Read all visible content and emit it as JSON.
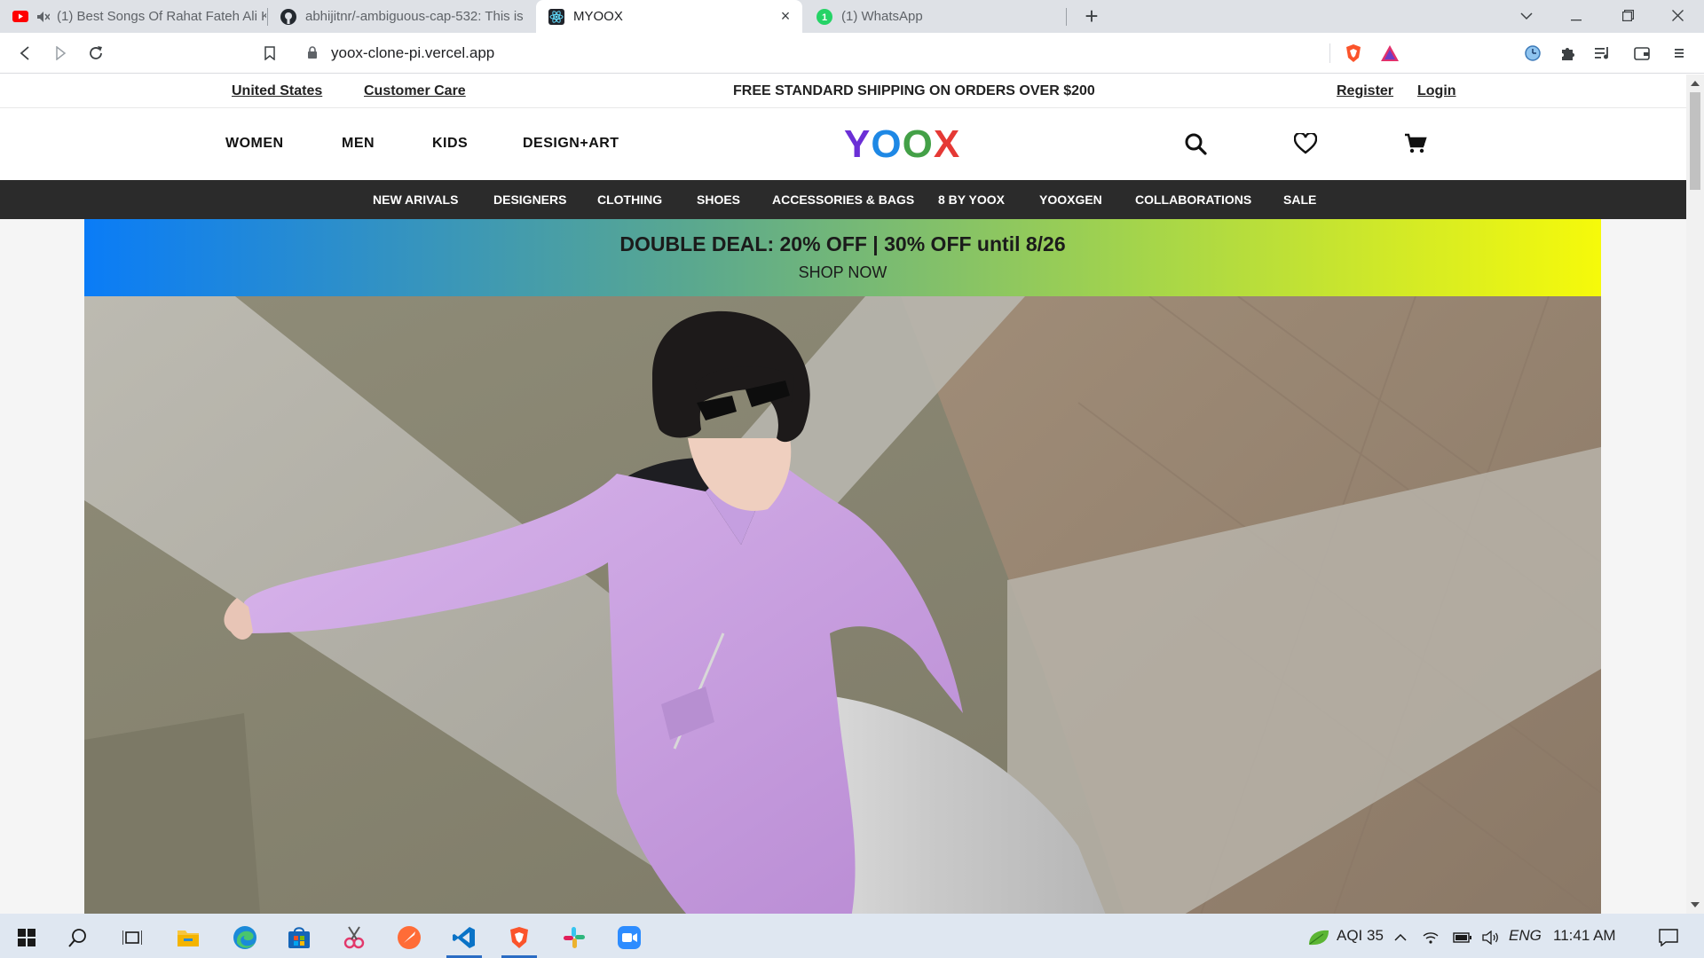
{
  "browser": {
    "tabs": [
      {
        "title": "(1) Best Songs Of Rahat Fateh Ali K",
        "icon": "youtube-icon",
        "muted": true
      },
      {
        "title": "abhijitnr/-ambiguous-cap-532: This is",
        "icon": "github-icon"
      },
      {
        "title": "MYOOX",
        "icon": "react-icon",
        "active": true
      },
      {
        "title": "(1) WhatsApp",
        "icon": "whatsapp-icon"
      }
    ],
    "url": "yoox-clone-pi.vercel.app",
    "new_tab": "+",
    "close_tab": "×",
    "window_controls": {
      "minimize": "—",
      "restore": "❐",
      "close": "✕"
    }
  },
  "page": {
    "topbar": {
      "country": "United States",
      "customer_care": "Customer Care",
      "shipping": "FREE STANDARD SHIPPING ON ORDERS OVER $200",
      "register": "Register",
      "login": "Login"
    },
    "mainnav": {
      "items": [
        "WOMEN",
        "MEN",
        "KIDS",
        "DESIGN+ART"
      ],
      "logo": [
        "Y",
        "O",
        "O",
        "X"
      ],
      "logo_colors": [
        "#6b2fd6",
        "#1e88e5",
        "#43a047",
        "#e53935"
      ]
    },
    "categories": [
      "NEW ARIVALS",
      "DESIGNERS",
      "CLOTHING",
      "SHOES",
      "ACCESSORIES & BAGS",
      "8 BY YOOX",
      "YOOXGEN",
      "COLLABORATIONS",
      "SALE"
    ],
    "promo": {
      "headline": "DOUBLE DEAL: 20% OFF | 30% OFF until 8/26",
      "cta": "SHOP NOW"
    }
  },
  "taskbar": {
    "apps": [
      "windows-start-icon",
      "search-icon",
      "task-view-icon",
      "file-explorer-icon",
      "edge-icon",
      "store-icon",
      "snipping-tool-icon",
      "postman-icon",
      "vscode-icon",
      "brave-icon",
      "slack-icon",
      "zoom-icon"
    ],
    "aqi": "AQI 35",
    "language": "ENG",
    "time": "11:41 AM"
  },
  "colors": {
    "catbar": "#2b2b2b",
    "promo_gradient": [
      "#0a7cf7",
      "#f6fa0a"
    ],
    "jacket": "#c9a3e0"
  }
}
